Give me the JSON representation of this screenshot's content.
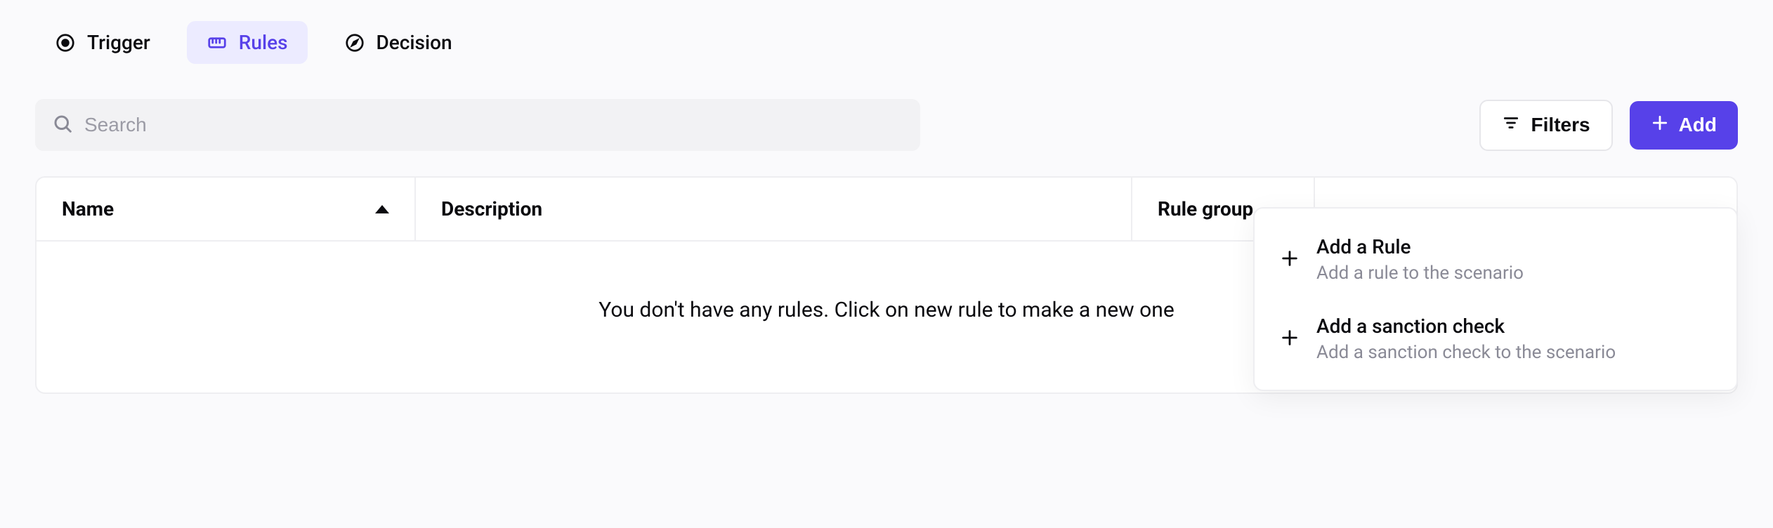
{
  "tabs": {
    "trigger": {
      "label": "Trigger",
      "icon": "target-icon"
    },
    "rules": {
      "label": "Rules",
      "icon": "ruler-icon",
      "active": true
    },
    "decision": {
      "label": "Decision",
      "icon": "compass-icon"
    }
  },
  "search": {
    "placeholder": "Search"
  },
  "toolbar": {
    "filters_label": "Filters",
    "add_label": "Add"
  },
  "table": {
    "columns": {
      "name": "Name",
      "description": "Description",
      "rule_group": "Rule group",
      "score": ""
    },
    "empty_message": "You don't have any rules. Click on new rule to make a new one"
  },
  "add_menu": {
    "items": [
      {
        "title": "Add a Rule",
        "description": "Add a rule to the scenario"
      },
      {
        "title": "Add a sanction check",
        "description": "Add a sanction check to the scenario"
      }
    ]
  },
  "colors": {
    "accent": "#5741e9"
  }
}
